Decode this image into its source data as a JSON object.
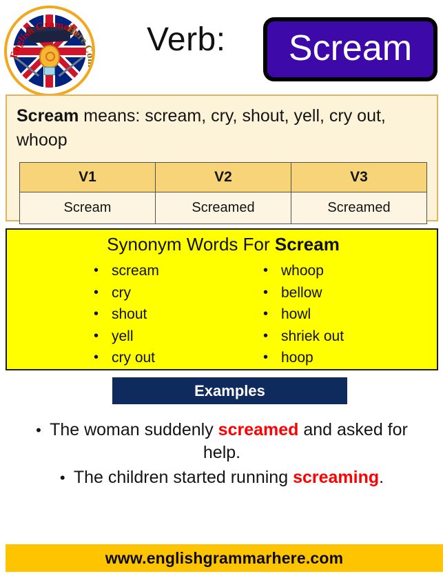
{
  "header": {
    "verb_label": "Verb:",
    "word": "Scream",
    "logo_alt": "English Grammar Here.Com",
    "logo_text_left": "English Grammar",
    "logo_text_right": "Here.Com",
    "badge_color": "#3d09a8",
    "badge_text_color": "#ffffff"
  },
  "meaning": {
    "word": "Scream",
    "lead": " means: ",
    "definition": "scream, cry, shout, yell, cry out, whoop",
    "box_bg": "#fdf3d8",
    "box_border": "#e0b35c"
  },
  "verb_table": {
    "headers": [
      "V1",
      "V2",
      "V3"
    ],
    "rows": [
      [
        "Scream",
        "Screamed",
        "Screamed"
      ]
    ],
    "header_bg": "#f8d479",
    "cell_bg": "#fdf5e2"
  },
  "synonyms": {
    "title_prefix": "Synonym Words For ",
    "title_word": "Scream",
    "bg": "#ffff00",
    "left_column": [
      "scream",
      "cry",
      "shout",
      "yell",
      "cry out"
    ],
    "right_column": [
      "whoop",
      "bellow",
      "howl",
      "shriek out",
      "hoop"
    ]
  },
  "examples": {
    "banner_label": "Examples",
    "banner_bg": "#0f2a5c",
    "highlight_color": "#ff0000",
    "items": [
      {
        "before": "The woman suddenly ",
        "highlight": "screamed",
        "after": " and asked for help."
      },
      {
        "before": "The children started running ",
        "highlight": "screaming",
        "after": "."
      }
    ]
  },
  "footer": {
    "url": "www.englishgrammarhere.com",
    "bg": "#ffc400"
  }
}
